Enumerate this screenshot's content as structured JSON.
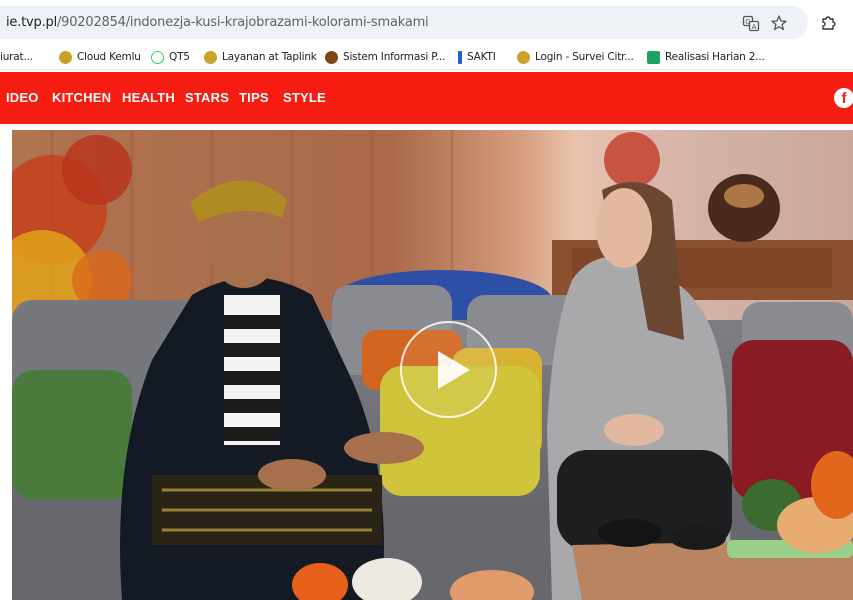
{
  "browser": {
    "url_host": "ie.tvp.pl",
    "url_path": "/90202854/indonezja-kusi-krajobrazami-kolorami-smakami",
    "icons": [
      "translate-icon",
      "star-icon",
      "extensions-icon"
    ]
  },
  "bookmarks": [
    {
      "label": "iurat...",
      "color": "#3a3a3a"
    },
    {
      "label": "Cloud Kemlu",
      "color": "#c9a227"
    },
    {
      "label": "QT5",
      "color": "#25d366"
    },
    {
      "label": "Layanan at Taplink",
      "color": "#c9a227"
    },
    {
      "label": "Sistem Informasi P...",
      "color": "#7a4a12"
    },
    {
      "label": "SAKTI",
      "color": "#1f5fd1"
    },
    {
      "label": "Login - Survei Citr...",
      "color": "#c9a227"
    },
    {
      "label": "Realisasi Harian 2...",
      "color": "#1aa260"
    }
  ],
  "nav": {
    "items": [
      "IDEO",
      "KITCHEN",
      "HEALTH",
      "STARS",
      "TIPS",
      "STYLE"
    ],
    "brand_color": "#f51d12",
    "facebook_label": "f"
  },
  "video": {
    "state": "paused",
    "icon": "play-icon"
  }
}
